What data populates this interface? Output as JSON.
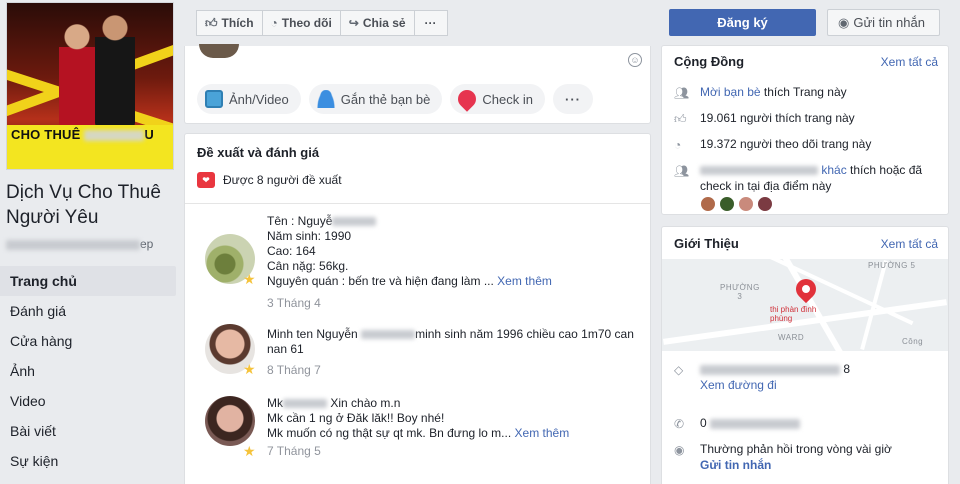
{
  "page": {
    "name": "Dịch Vụ Cho Thuê Người Yêu",
    "handle_suffix": "ep",
    "cover_caption_visible": "CHO THUÊ",
    "cover_caption_end": "U"
  },
  "left_nav": {
    "items": [
      {
        "label": "Trang chủ",
        "active": true
      },
      {
        "label": "Đánh giá"
      },
      {
        "label": "Cửa hàng"
      },
      {
        "label": "Ảnh"
      },
      {
        "label": "Video"
      },
      {
        "label": "Bài viết"
      },
      {
        "label": "Sự kiện"
      }
    ]
  },
  "actionbar": {
    "like": "Thích",
    "follow": "Theo dõi",
    "share": "Chia sẻ",
    "more": "···",
    "signup": "Đăng ký",
    "message": "Gửi tin nhắn"
  },
  "composer": {
    "photo_video": "Ảnh/Video",
    "tag_friends": "Gắn thẻ bạn bè",
    "check_in": "Check in",
    "more": "···"
  },
  "reviews": {
    "title": "Đề xuất và đánh giá",
    "recommended": "Được 8 người đề xuất",
    "items": [
      {
        "line1_prefix": "Tên : Nguyễ",
        "lines": "Năm sinh: 1990\nCao: 164\nCân nặg: 56kg.",
        "last_line": "Nguyên quán : bến tre và hiện đang làm ...",
        "more": "Xem thêm",
        "time": "3 Tháng 4"
      },
      {
        "line1_prefix": "Minh ten Nguyễn",
        "line1_suffix": "minh sinh năm 1996 chiều cao 1m70 can",
        "line2": "nan 61",
        "time": "8 Tháng 7"
      },
      {
        "line1_prefix": "Mk",
        "line1_suffix": "Xin chào m.n",
        "line2": "Mk cần 1 ng ở Đăk lăk!! Boy nhé!",
        "last_line": "Mk muốn có ng thật sự qt mk. Bn đưng lo m...",
        "more": "Xem thêm",
        "time": "7 Tháng 5"
      }
    ]
  },
  "community": {
    "title": "Cộng Đồng",
    "see_all": "Xem tất cả",
    "invite_link": "Mời bạn bè",
    "invite_rest": "thích Trang này",
    "likes": "19.061 người thích trang này",
    "follows": "19.372 người theo dõi trang này",
    "friends_link": "khác",
    "friends_rest": "thích hoặc đã check in tại địa điểm này"
  },
  "about": {
    "title": "Giới Thiệu",
    "see_all": "Xem tất cả",
    "address_suffix": "8",
    "directions": "Xem đường đi",
    "phone_prefix": "0",
    "response": "Thường phản hồi trong vòng vài giờ",
    "send_message": "Gửi tin nhắn",
    "map_labels": {
      "phuong5": "PHƯỜNG 5",
      "phuong3": "PHƯỜNG\n3",
      "ward": "WARD",
      "pin_label": "thi phàn đình\nphùng",
      "cong": "Công"
    }
  },
  "colors": {
    "facebook_blue": "#4267b2",
    "page_bg": "#e9ebee",
    "star": "#f5c33b",
    "pin_red": "#e1323b"
  }
}
